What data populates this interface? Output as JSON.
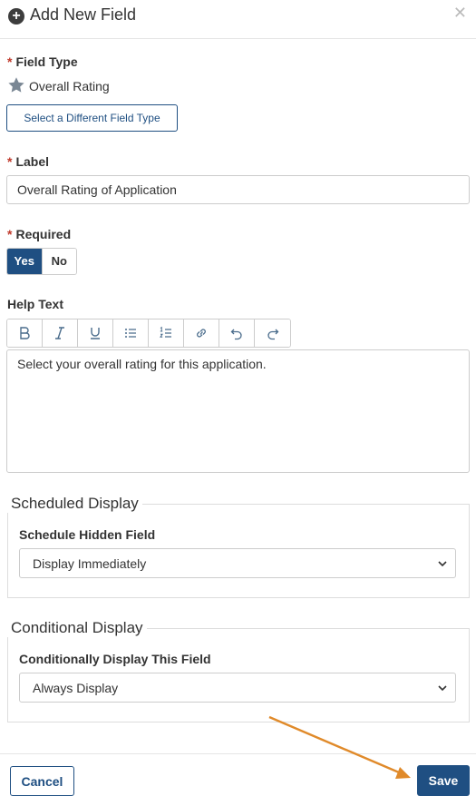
{
  "header": {
    "title": "Add New Field",
    "add_icon": "plus-circle-icon",
    "close_icon": "close-icon"
  },
  "field_type": {
    "label": "Field Type",
    "required_mark": "*",
    "icon": "star-icon",
    "value": "Overall Rating",
    "change_button": "Select a Different Field Type"
  },
  "label_field": {
    "label": "Label",
    "required_mark": "*",
    "value": "Overall Rating of Application"
  },
  "required": {
    "label": "Required",
    "required_mark": "*",
    "yes": "Yes",
    "no": "No",
    "selected": "Yes"
  },
  "help_text": {
    "label": "Help Text",
    "toolbar": [
      "bold-icon",
      "italic-icon",
      "underline-icon",
      "bulleted-list-icon",
      "numbered-list-icon",
      "link-icon",
      "undo-icon",
      "redo-icon"
    ],
    "value": "Select your overall rating for this application."
  },
  "scheduled_display": {
    "legend": "Scheduled Display",
    "field_label": "Schedule Hidden Field",
    "selected": "Display Immediately"
  },
  "conditional_display": {
    "legend": "Conditional Display",
    "field_label": "Conditionally Display This Field",
    "selected": "Always Display"
  },
  "footer": {
    "cancel": "Cancel",
    "save": "Save"
  },
  "colors": {
    "primary": "#1f4f82",
    "required": "#c0392b",
    "annotation_arrow": "#e08a2a"
  }
}
